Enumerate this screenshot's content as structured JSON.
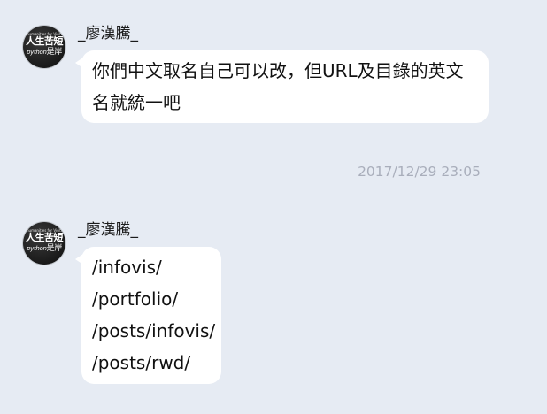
{
  "messages": [
    {
      "sender": "_廖漢騰_",
      "avatar": {
        "top": "humanities for VisitNthenare",
        "main": "人生苦短",
        "sub_italic": "python",
        "sub": "是岸"
      },
      "lines": [
        "你們中文取名自己可以改，但URL及目錄的英文",
        "名就統一吧"
      ]
    },
    {
      "sender": "_廖漢騰_",
      "avatar": {
        "top": "humanities for VisitNthenare",
        "main": "人生苦短",
        "sub_italic": "python",
        "sub": "是岸"
      },
      "lines": [
        "/infovis/",
        "/portfolio/",
        "/posts/infovis/",
        "/posts/rwd/"
      ]
    }
  ],
  "timestamp": "2017/12/29 23:05",
  "colors": {
    "background": "#e6ebf3",
    "bubble": "#ffffff",
    "timestamp": "#a9aebb",
    "text": "#111111"
  }
}
